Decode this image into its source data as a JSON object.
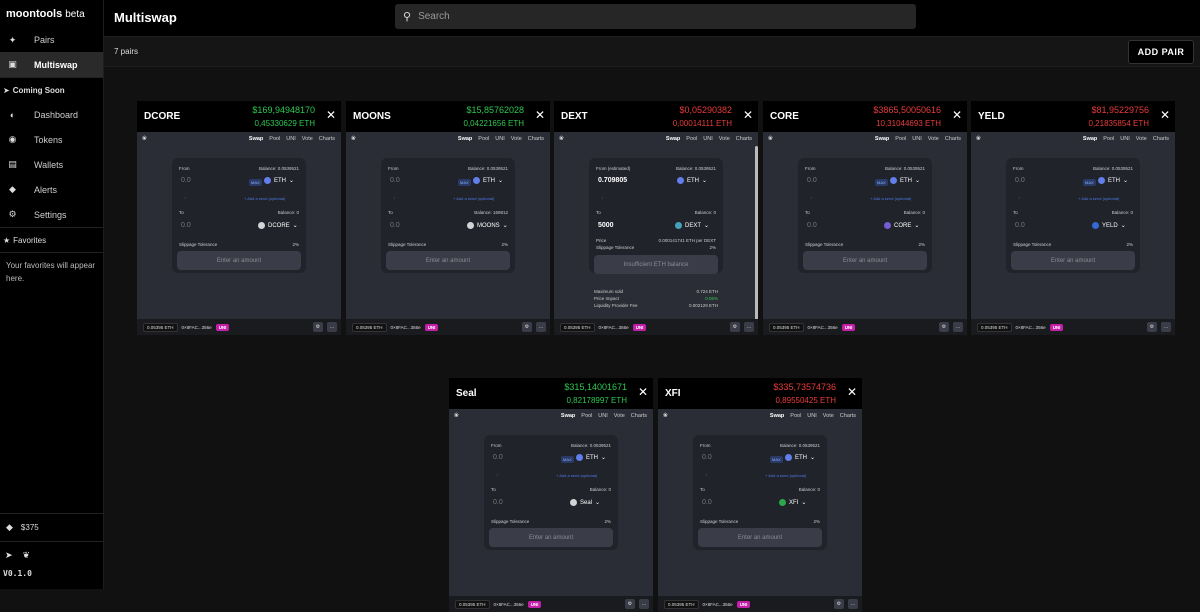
{
  "app": {
    "brand": "moontools",
    "beta": "beta",
    "version": "V0.1.0"
  },
  "sidebar": {
    "items": [
      {
        "label": "Pairs",
        "icon": "pin-icon"
      },
      {
        "label": "Multiswap",
        "icon": "layers-icon"
      }
    ],
    "coming_soon": "Coming Soon",
    "soon_items": [
      {
        "label": "Dashboard",
        "icon": "gauge-icon"
      },
      {
        "label": "Tokens",
        "icon": "coins-icon"
      },
      {
        "label": "Wallets",
        "icon": "wallet-icon"
      },
      {
        "label": "Alerts",
        "icon": "bell-icon"
      },
      {
        "label": "Settings",
        "icon": "gear-icon"
      }
    ],
    "favorites_label": "Favorites",
    "favorites_note": "Your favorites will appear here.",
    "eth_price": "$375"
  },
  "header": {
    "title": "Multiswap",
    "search_placeholder": "Search"
  },
  "subbar": {
    "pairs_count": "7 pairs",
    "add_pair": "ADD PAIR"
  },
  "widget": {
    "tabs": [
      "Swap",
      "Pool",
      "UNI",
      "Vote",
      "Charts"
    ],
    "from": "From",
    "from_estimated": "From (estimated)",
    "to": "To",
    "balance": "Balance: 0.0539521",
    "balance_to": "Balance: 0",
    "max": "MAX",
    "eth": "ETH",
    "placeholder": "0.0",
    "add_recipient": "+ Add a send (optional)",
    "slippage": "Slippage Tolerance",
    "slippage_val": "2%",
    "enter_amount": "Enter an amount",
    "insufficient": "Insufficient ETH balance",
    "foot_eth": "0.05395 ETH",
    "foot_addr": "0×8FAC...356e",
    "uni": "UNI"
  },
  "cards": [
    {
      "name": "DCORE",
      "price": "$169,94948170",
      "eth": "0,45330629 ETH",
      "trend": "up",
      "token": "DCORE",
      "token_color": "#ffffff"
    },
    {
      "name": "MOONS",
      "price": "$15,85762028",
      "eth": "0,04221656 ETH",
      "trend": "up",
      "token": "MOONS",
      "token_color": "#ffffff",
      "to_balance": "Balance: 169812"
    },
    {
      "name": "DEXT",
      "price": "$0,05290382",
      "eth": "0,00014111 ETH",
      "trend": "down",
      "token": "DEXT",
      "token_color": "#4ec3e0",
      "from_val": "0.709805",
      "to_val": "5000",
      "price_label": "Price",
      "price_val": "0.000141741 ETH per DEXT",
      "max_sold": "Maximum sold",
      "max_sold_val": "0.724 ETH",
      "impact": "Price Impact",
      "impact_val": "0.06%",
      "lp_fee": "Liquidity Provider Fee",
      "lp_fee_val": "0.002129 ETH"
    },
    {
      "name": "CORE",
      "price": "$3865,50050616",
      "eth": "10,31044693 ETH",
      "trend": "down",
      "token": "CORE",
      "token_color": "#8a6bff"
    },
    {
      "name": "YELD",
      "price": "$81,95229756",
      "eth": "0,21835854 ETH",
      "trend": "down",
      "token": "YELD",
      "token_color": "#3a7bff"
    },
    {
      "name": "Seal",
      "price": "$315,14001671",
      "eth": "0,82178997 ETH",
      "trend": "up",
      "token": "Seal",
      "token_color": "#ffffff"
    },
    {
      "name": "XFI",
      "price": "$335,73574736",
      "eth": "0,89550425 ETH",
      "trend": "down",
      "token": "XFI",
      "token_color": "#2fc852"
    }
  ]
}
